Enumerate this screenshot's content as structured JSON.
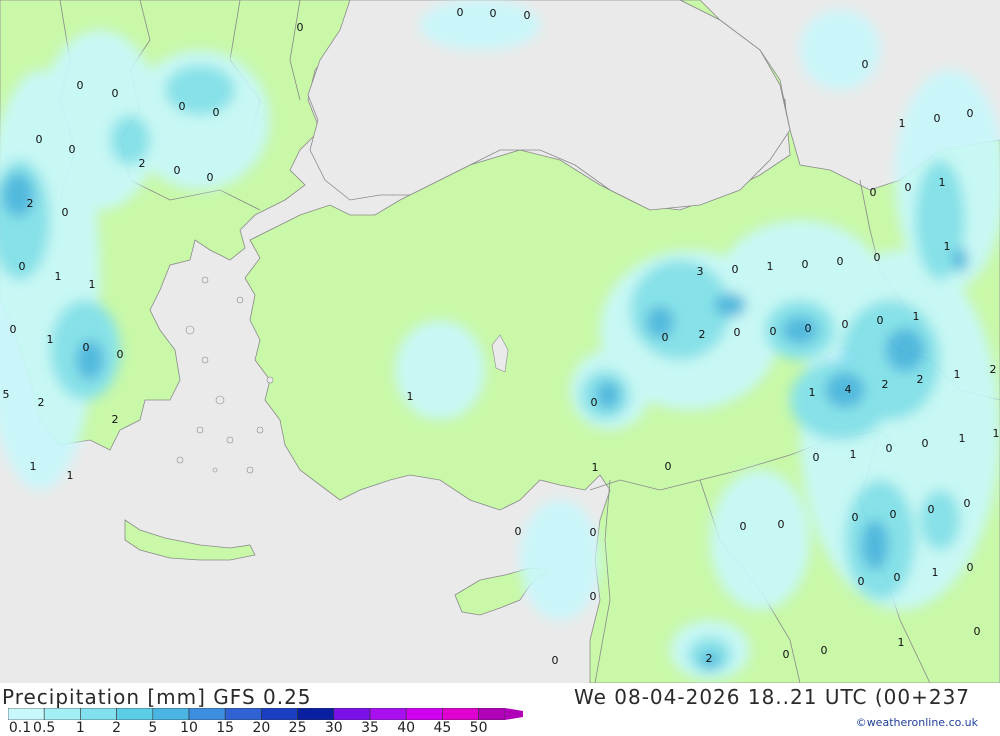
{
  "title": {
    "left": "Precipitation [mm] GFS 0.25",
    "right": "We 08-04-2026 18..21 UTC (00+237"
  },
  "credit": "©weatheronline.co.uk",
  "legend": {
    "ticks": [
      "0.1",
      "0.5",
      "1",
      "2",
      "5",
      "10",
      "15",
      "20",
      "25",
      "30",
      "35",
      "40",
      "45",
      "50"
    ],
    "colors": [
      "#c8f8fb",
      "#a4eef5",
      "#82e0ee",
      "#5ccde6",
      "#4ab4e2",
      "#3d8de0",
      "#2f63d3",
      "#1a3ec0",
      "#0a1ea0",
      "#7b10e8",
      "#a810f0",
      "#d000f0",
      "#e000d0",
      "#b000b8"
    ]
  },
  "map": {
    "colors": {
      "sea": "#eaeaea",
      "land": "#c8f8a8",
      "border": "#8a8a8a"
    },
    "value_labels": [
      "0",
      "0",
      "0",
      "0",
      "0",
      "0",
      "0",
      "0",
      "0",
      "2",
      "0",
      "1",
      "0",
      "0",
      "0",
      "0",
      "0",
      "2",
      "0",
      "0",
      "1",
      "0",
      "1",
      "0",
      "1",
      "1",
      "3",
      "0",
      "1",
      "0",
      "0",
      "0",
      "0",
      "1",
      "0",
      "0",
      "2",
      "0",
      "0",
      "0",
      "0",
      "0",
      "1",
      "0",
      "0",
      "1",
      "4",
      "2",
      "2",
      "1",
      "2",
      "5",
      "2",
      "2",
      "1",
      "0",
      "1",
      "1",
      "0",
      "1",
      "0",
      "1",
      "1",
      "1",
      "0",
      "0",
      "0",
      "0",
      "0",
      "0",
      "0",
      "0",
      "0",
      "0",
      "0",
      "1",
      "0",
      "0",
      "2",
      "0",
      "0",
      "1",
      "0",
      "0",
      "0"
    ]
  }
}
